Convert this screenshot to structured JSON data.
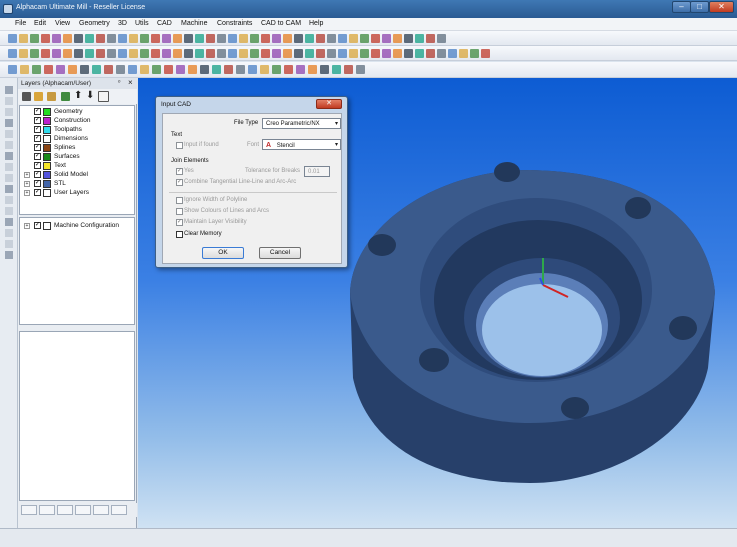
{
  "window": {
    "title": "Alphacam Ultimate Mill - Reseller License",
    "minimize": "–",
    "maximize": "□",
    "close": "✕"
  },
  "menu": [
    "File",
    "Edit",
    "View",
    "Geometry",
    "3D",
    "Utils",
    "CAD",
    "Machine",
    "Constraints",
    "CAD to CAM",
    "Help"
  ],
  "panel": {
    "title": "Layers (Alphacam/User)",
    "pin": "ᵒ",
    "close": "×",
    "layers": [
      {
        "label": "Geometry",
        "color": "#22dd22",
        "checked": "✓"
      },
      {
        "label": "Construction",
        "color": "#bb22cc",
        "checked": "✓"
      },
      {
        "label": "Toolpaths",
        "color": "#33ddee",
        "checked": "✓"
      },
      {
        "label": "Dimensions",
        "color": "#ffffff",
        "checked": "✓"
      },
      {
        "label": "Splines",
        "color": "#8b4513",
        "checked": "✓"
      },
      {
        "label": "Surfaces",
        "color": "#1a8a1a",
        "checked": "✓"
      },
      {
        "label": "Text",
        "color": "#f5e62a",
        "checked": "✓"
      },
      {
        "label": "Solid Model",
        "color": "#5555dd",
        "checked": "✓",
        "expander": "+"
      },
      {
        "label": "STL",
        "color": "#4466aa",
        "checked": "✓",
        "expander": "+"
      },
      {
        "label": "User Layers",
        "color": "#ffffff",
        "checked": "✓",
        "expander": "+"
      }
    ],
    "machine_config": {
      "label": "Machine Configuration",
      "checked": "✓",
      "expander": "+"
    }
  },
  "dialog": {
    "title": "Input CAD",
    "close": "✕",
    "file_type_label": "File Type",
    "file_type_value": "Creo Parametric/NX",
    "dropdown_arrow": "▾",
    "text_group": "Text",
    "input_if_found": "Input if found",
    "font_label": "Font",
    "font_icon": "A",
    "font_value": "Stencil",
    "join_group": "Join Elements",
    "yes_label": "Yes",
    "yes_checked": "✓",
    "tolerance_label": "Tolerance for Breaks",
    "tolerance_value": "0.01",
    "combine_label": "Combine Tangential Line-Line and Arc-Arc",
    "combine_checked": "✓",
    "ignore_width_label": "Ignore Width of Polyline",
    "show_colours_label": "Show Colours of Lines and Arcs",
    "maintain_vis_label": "Maintain Layer Visibility",
    "maintain_vis_checked": "✓",
    "clear_memory_label": "Clear Memory",
    "ok_label": "OK",
    "cancel_label": "Cancel"
  },
  "model": {
    "face_color": "#33507c",
    "hole_color": "#22385a"
  }
}
